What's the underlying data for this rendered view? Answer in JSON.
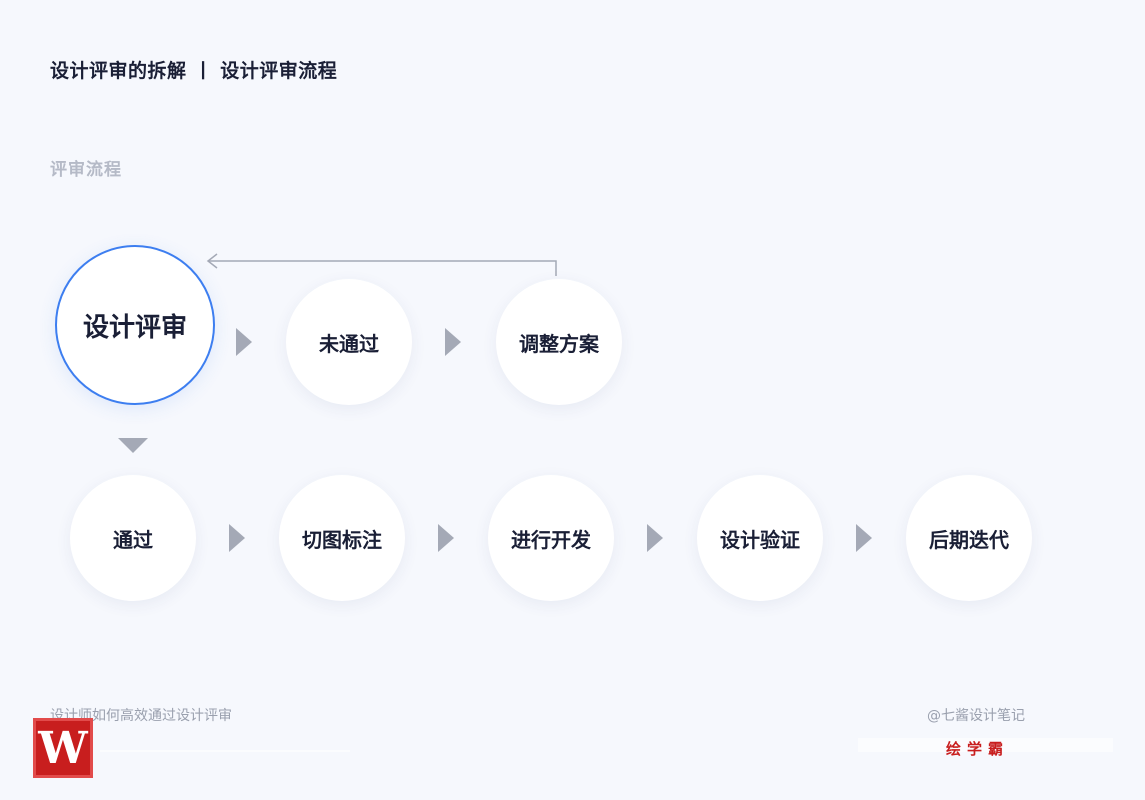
{
  "header": {
    "title": "设计评审的拆解 丨 设计评审流程",
    "section_label": "评审流程"
  },
  "flow": {
    "row1": [
      {
        "label": "设计评审",
        "highlighted": true
      },
      {
        "label": "未通过",
        "highlighted": false
      },
      {
        "label": "调整方案",
        "highlighted": false
      }
    ],
    "row2": [
      {
        "label": "通过"
      },
      {
        "label": "切图标注"
      },
      {
        "label": "进行开发"
      },
      {
        "label": "设计验证"
      },
      {
        "label": "后期迭代"
      }
    ],
    "loop_back": {
      "from": "调整方案",
      "to": "设计评审"
    }
  },
  "footer": {
    "left_text": "设计师如何高效通过设计评审",
    "right_text": "@七酱设计笔记",
    "stamp_text": "绘学霸",
    "logo_letter": "W"
  },
  "colors": {
    "background": "#f6f8fd",
    "highlight_border": "#3d7ef0",
    "arrow": "#a4a9b6",
    "text_dark": "#1a1f36",
    "text_muted": "#b5bac7",
    "brand_red": "#c81e1e"
  }
}
